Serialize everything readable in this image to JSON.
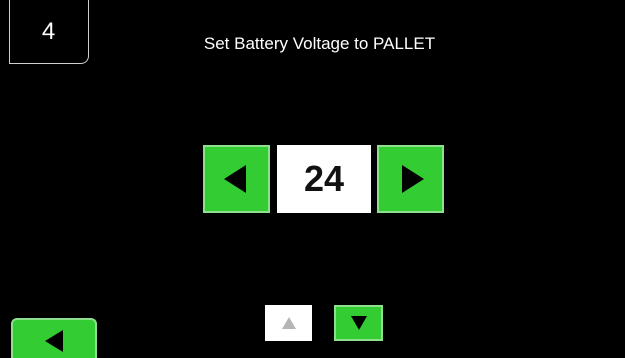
{
  "header": {
    "step_number": "4",
    "title": "Set Battery Voltage to PALLET"
  },
  "selector": {
    "value": "24",
    "decrease_icon": "left-triangle-icon",
    "increase_icon": "right-triangle-icon"
  },
  "footer": {
    "back_icon": "left-triangle-icon",
    "scroll_up_icon": "up-triangle-icon",
    "scroll_down_icon": "down-triangle-icon",
    "scroll_up_enabled": false,
    "scroll_down_enabled": true
  },
  "colors": {
    "background": "#000000",
    "button_green": "#33cc33",
    "button_green_border": "#8ee08e",
    "value_box": "#ffffff",
    "disabled_icon": "#b5b5b5"
  }
}
